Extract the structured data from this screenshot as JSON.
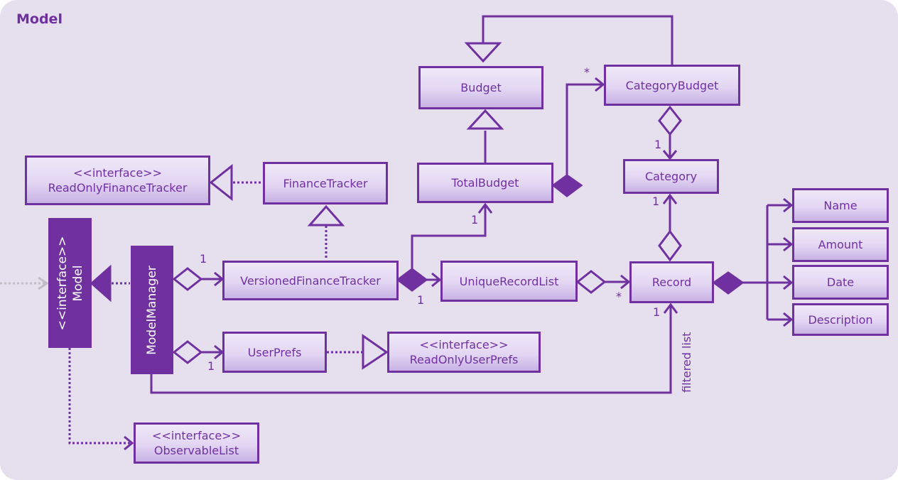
{
  "diagram": {
    "title": "Model",
    "colors": {
      "accent": "#7030a0",
      "background": "#e5dfee",
      "box_top": "#efe8f8",
      "box_bottom": "#c8b2e4"
    },
    "classes": {
      "read_only_finance_tracker": {
        "stereotype": "<<interface>>",
        "name": "ReadOnlyFinanceTracker"
      },
      "finance_tracker": {
        "name": "FinanceTracker"
      },
      "budget": {
        "name": "Budget"
      },
      "total_budget": {
        "name": "TotalBudget"
      },
      "category_budget": {
        "name": "CategoryBudget"
      },
      "category": {
        "name": "Category"
      },
      "model": {
        "stereotype": "<<interface>>",
        "name": "Model"
      },
      "model_manager": {
        "name": "ModelManager"
      },
      "versioned_finance_tracker": {
        "name": "VersionedFinanceTracker"
      },
      "unique_record_list": {
        "name": "UniqueRecordList"
      },
      "record": {
        "name": "Record"
      },
      "name": {
        "name": "Name"
      },
      "amount": {
        "name": "Amount"
      },
      "date": {
        "name": "Date"
      },
      "description": {
        "name": "Description"
      },
      "user_prefs": {
        "name": "UserPrefs"
      },
      "read_only_user_prefs": {
        "stereotype": "<<interface>>",
        "name": "ReadOnlyUserPrefs"
      },
      "observable_list": {
        "stereotype": "<<interface>>",
        "name": "ObservableList"
      }
    },
    "multiplicities": {
      "modelmanager_versioned": "1",
      "versioned_totalbudget": "1",
      "versioned_uniquerecordlist": "1",
      "totalbudget_categorybudget": "*",
      "categorybudget_category": "1",
      "record_category": "1",
      "uniquerecordlist_record": "*",
      "modelmanager_record": "1",
      "modelmanager_userprefs": "1"
    },
    "edge_labels": {
      "filtered_list": "filtered list"
    },
    "relationships": [
      "FinanceTracker realizes ReadOnlyFinanceTracker",
      "VersionedFinanceTracker extends FinanceTracker",
      "ModelManager realizes Model",
      "ModelManager aggregates VersionedFinanceTracker",
      "ModelManager aggregates UserPrefs",
      "UserPrefs realizes ReadOnlyUserPrefs",
      "VersionedFinanceTracker composes TotalBudget",
      "VersionedFinanceTracker composes UniqueRecordList",
      "TotalBudget extends Budget",
      "CategoryBudget extends Budget",
      "TotalBudget composes CategoryBudget",
      "CategoryBudget aggregates Category",
      "UniqueRecordList aggregates Record",
      "Record aggregates Category",
      "Record composes Name, Amount, Date, Description",
      "ModelManager filtered list Record",
      "Model depends on ObservableList"
    ]
  }
}
